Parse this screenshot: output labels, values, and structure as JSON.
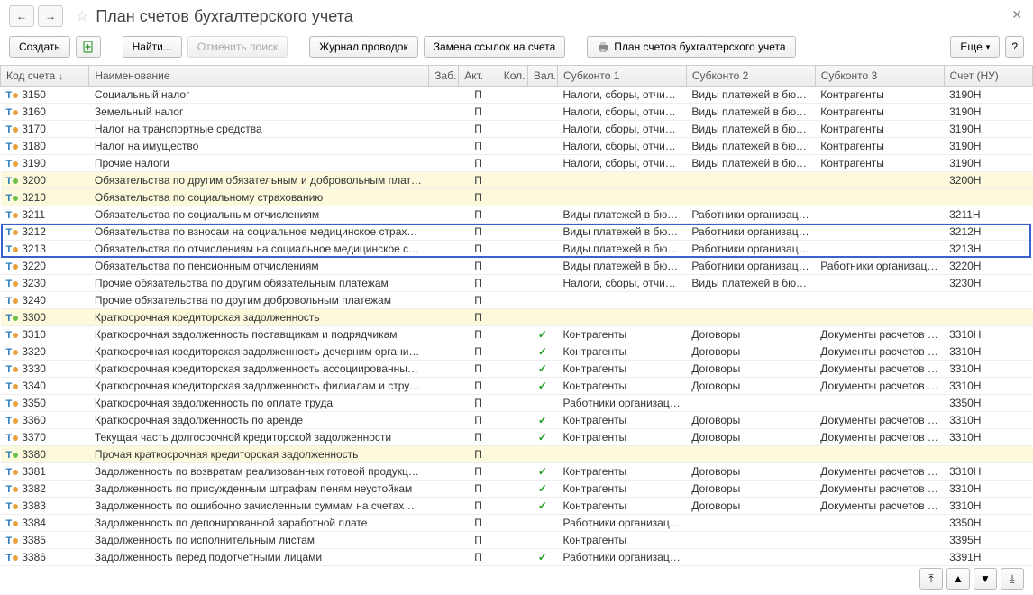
{
  "title": "План счетов бухгалтерского учета",
  "toolbar": {
    "create": "Создать",
    "find": "Найти...",
    "cancel_search": "Отменить поиск",
    "journal": "Журнал проводок",
    "replace_links": "Замена ссылок на счета",
    "print_plan": "План счетов бухгалтерского учета",
    "more": "Еще"
  },
  "columns": {
    "code": "Код счета",
    "name": "Наименование",
    "zab": "Заб.",
    "akt": "Акт.",
    "kol": "Кол.",
    "val": "Вал.",
    "sk1": "Субконто 1",
    "sk2": "Субконто 2",
    "sk3": "Субконто 3",
    "nu": "Счет (НУ)"
  },
  "rows": [
    {
      "code": "3150",
      "dot": "orange",
      "name": "Социальный налог",
      "akt": "П",
      "tick": false,
      "sk1": "Налоги, сборы, отчисле…",
      "sk2": "Виды платежей в бюдж…",
      "sk3": "Контрагенты",
      "nu": "3190Н",
      "hl": false
    },
    {
      "code": "3160",
      "dot": "orange",
      "name": "Земельный налог",
      "akt": "П",
      "tick": false,
      "sk1": "Налоги, сборы, отчисле…",
      "sk2": "Виды платежей в бюдж…",
      "sk3": "Контрагенты",
      "nu": "3190Н",
      "hl": false
    },
    {
      "code": "3170",
      "dot": "orange",
      "name": "Налог на транспортные средства",
      "akt": "П",
      "tick": false,
      "sk1": "Налоги, сборы, отчисле…",
      "sk2": "Виды платежей в бюдж…",
      "sk3": "Контрагенты",
      "nu": "3190Н",
      "hl": false
    },
    {
      "code": "3180",
      "dot": "orange",
      "name": "Налог на имущество",
      "akt": "П",
      "tick": false,
      "sk1": "Налоги, сборы, отчисле…",
      "sk2": "Виды платежей в бюдж…",
      "sk3": "Контрагенты",
      "nu": "3190Н",
      "hl": false
    },
    {
      "code": "3190",
      "dot": "orange",
      "name": "Прочие налоги",
      "akt": "П",
      "tick": false,
      "sk1": "Налоги, сборы, отчисле…",
      "sk2": "Виды платежей в бюдж…",
      "sk3": "Контрагенты",
      "nu": "3190Н",
      "hl": false
    },
    {
      "code": "3200",
      "dot": "green",
      "name": "Обязательства по другим обязательным и добровольным платежам",
      "akt": "П",
      "tick": false,
      "sk1": "",
      "sk2": "",
      "sk3": "",
      "nu": "3200Н",
      "hl": true
    },
    {
      "code": "3210",
      "dot": "green",
      "name": "Обязательства по социальному страхованию",
      "akt": "П",
      "tick": false,
      "sk1": "",
      "sk2": "",
      "sk3": "",
      "nu": "",
      "hl": true
    },
    {
      "code": "3211",
      "dot": "orange",
      "name": "Обязательства по социальным отчислениям",
      "akt": "П",
      "tick": false,
      "sk1": "Виды платежей в бюдж…",
      "sk2": "Работники организации",
      "sk3": "",
      "nu": "3211Н",
      "hl": false
    },
    {
      "code": "3212",
      "dot": "orange",
      "name": "Обязательства по взносам на социальное медицинское страхование",
      "akt": "П",
      "tick": false,
      "sk1": "Виды платежей в бюдж…",
      "sk2": "Работники организации",
      "sk3": "",
      "nu": "3212Н",
      "hl": false,
      "sel": true
    },
    {
      "code": "3213",
      "dot": "orange",
      "name": "Обязательства по отчислениям на социальное медицинское страхо…",
      "akt": "П",
      "tick": false,
      "sk1": "Виды платежей в бюдж…",
      "sk2": "Работники организации",
      "sk3": "",
      "nu": "3213Н",
      "hl": false,
      "sel": true
    },
    {
      "code": "3220",
      "dot": "orange",
      "name": "Обязательства по пенсионным отчислениям",
      "akt": "П",
      "tick": false,
      "sk1": "Виды платежей в бюдж…",
      "sk2": "Работники организации",
      "sk3": "Работники организации",
      "nu": "3220Н",
      "hl": false
    },
    {
      "code": "3230",
      "dot": "orange",
      "name": "Прочие обязательства по другим обязательным платежам",
      "akt": "П",
      "tick": false,
      "sk1": "Налоги, сборы, отчисле…",
      "sk2": "Виды платежей в бюдж…",
      "sk3": "",
      "nu": "3230Н",
      "hl": false
    },
    {
      "code": "3240",
      "dot": "orange",
      "name": "Прочие обязательства по другим добровольным платежам",
      "akt": "П",
      "tick": false,
      "sk1": "",
      "sk2": "",
      "sk3": "",
      "nu": "",
      "hl": false
    },
    {
      "code": "3300",
      "dot": "green",
      "name": "Краткосрочная кредиторская задолженность",
      "akt": "П",
      "tick": false,
      "sk1": "",
      "sk2": "",
      "sk3": "",
      "nu": "",
      "hl": true
    },
    {
      "code": "3310",
      "dot": "orange",
      "name": "Краткосрочная задолженность поставщикам и подрядчикам",
      "akt": "П",
      "tick": true,
      "sk1": "Контрагенты",
      "sk2": "Договоры",
      "sk3": "Документы расчетов с …",
      "nu": "3310Н",
      "hl": false
    },
    {
      "code": "3320",
      "dot": "orange",
      "name": "Краткосрочная кредиторская задолженность дочерним организаци…",
      "akt": "П",
      "tick": true,
      "sk1": "Контрагенты",
      "sk2": "Договоры",
      "sk3": "Документы расчетов с …",
      "nu": "3310Н",
      "hl": false
    },
    {
      "code": "3330",
      "dot": "orange",
      "name": "Краткосрочная кредиторская задолженность ассоциированным и с…",
      "akt": "П",
      "tick": true,
      "sk1": "Контрагенты",
      "sk2": "Договоры",
      "sk3": "Документы расчетов с …",
      "nu": "3310Н",
      "hl": false
    },
    {
      "code": "3340",
      "dot": "orange",
      "name": "Краткосрочная кредиторская задолженность филиалам и структур…",
      "akt": "П",
      "tick": true,
      "sk1": "Контрагенты",
      "sk2": "Договоры",
      "sk3": "Документы расчетов с …",
      "nu": "3310Н",
      "hl": false
    },
    {
      "code": "3350",
      "dot": "orange",
      "name": "Краткосрочная задолженность по оплате труда",
      "akt": "П",
      "tick": false,
      "sk1": "Работники организации",
      "sk2": "",
      "sk3": "",
      "nu": "3350Н",
      "hl": false
    },
    {
      "code": "3360",
      "dot": "orange",
      "name": "Краткосрочная задолженность по аренде",
      "akt": "П",
      "tick": true,
      "sk1": "Контрагенты",
      "sk2": "Договоры",
      "sk3": "Документы расчетов с …",
      "nu": "3310Н",
      "hl": false
    },
    {
      "code": "3370",
      "dot": "orange",
      "name": "Текущая часть долгосрочной кредиторской задолженности",
      "akt": "П",
      "tick": true,
      "sk1": "Контрагенты",
      "sk2": "Договоры",
      "sk3": "Документы расчетов с …",
      "nu": "3310Н",
      "hl": false
    },
    {
      "code": "3380",
      "dot": "green",
      "name": "Прочая краткосрочная кредиторская задолженность",
      "akt": "П",
      "tick": false,
      "sk1": "",
      "sk2": "",
      "sk3": "",
      "nu": "",
      "hl": true
    },
    {
      "code": "3381",
      "dot": "orange",
      "name": "Задолженность по возвратам реализованных готовой продукции, т…",
      "akt": "П",
      "tick": true,
      "sk1": "Контрагенты",
      "sk2": "Договоры",
      "sk3": "Документы расчетов с …",
      "nu": "3310Н",
      "hl": false
    },
    {
      "code": "3382",
      "dot": "orange",
      "name": "Задолженность по присужденным штрафам пеням неустойкам",
      "akt": "П",
      "tick": true,
      "sk1": "Контрагенты",
      "sk2": "Договоры",
      "sk3": "Документы расчетов с …",
      "nu": "3310Н",
      "hl": false
    },
    {
      "code": "3383",
      "dot": "orange",
      "name": "Задолженность по ошибочно зачисленным суммам на счетах в бан…",
      "akt": "П",
      "tick": true,
      "sk1": "Контрагенты",
      "sk2": "Договоры",
      "sk3": "Документы расчетов с …",
      "nu": "3310Н",
      "hl": false
    },
    {
      "code": "3384",
      "dot": "orange",
      "name": "Задолженность по депонированной заработной плате",
      "akt": "П",
      "tick": false,
      "sk1": "Работники организации",
      "sk2": "",
      "sk3": "",
      "nu": "3350Н",
      "hl": false
    },
    {
      "code": "3385",
      "dot": "orange",
      "name": "Задолженность по исполнительным листам",
      "akt": "П",
      "tick": false,
      "sk1": "Контрагенты",
      "sk2": "",
      "sk3": "",
      "nu": "3395Н",
      "hl": false
    },
    {
      "code": "3386",
      "dot": "orange",
      "name": "Задолженность перед подотчетными лицами",
      "akt": "П",
      "tick": true,
      "sk1": "Работники организации",
      "sk2": "",
      "sk3": "",
      "nu": "3391Н",
      "hl": false
    }
  ]
}
